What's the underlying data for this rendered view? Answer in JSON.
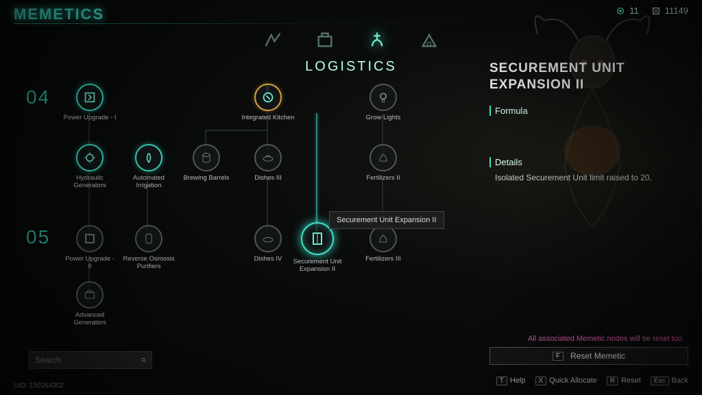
{
  "header": {
    "title": "MEMETICS",
    "currency1": "11",
    "currency2": "11149"
  },
  "tree": {
    "title": "LOGISTICS",
    "tier04": "04",
    "tier05": "05"
  },
  "nodes": {
    "n1": "Power Upgrade - I",
    "n2": "Integrated Kitchen",
    "n3": "Grow Lights",
    "n4": "Hydraulic Generators",
    "n5": "Automated Irrigation",
    "n6": "Brewing Barrels",
    "n7": "Dishes III",
    "n8": "Fertilizers II",
    "n9": "Power Upgrade - II",
    "n10": "Reverse Osmosis Purifiers",
    "n11": "Dishes IV",
    "n12": "Securement Unit Expansion II",
    "n13": "Fertilizers III",
    "n14": "Advanced Generators"
  },
  "tooltip": "Securement Unit Expansion II",
  "panel": {
    "title": "SECUREMENT UNIT EXPANSION II",
    "formula_h": "Formula",
    "details_h": "Details",
    "details": "Isolated Securement Unit limit raised to 20."
  },
  "warn": "All associated Memetic nodes will be reset too.",
  "reset": {
    "key": "F",
    "label": "Reset Memetic"
  },
  "hints": {
    "help_k": "T",
    "help": "Help",
    "quick_k": "X",
    "quick": "Quick Allocate",
    "reset_k": "R",
    "reset": "Reset",
    "back_k": "Esc",
    "back": "Back"
  },
  "search": {
    "placeholder": "Search"
  },
  "uid": "UID: 150264302"
}
